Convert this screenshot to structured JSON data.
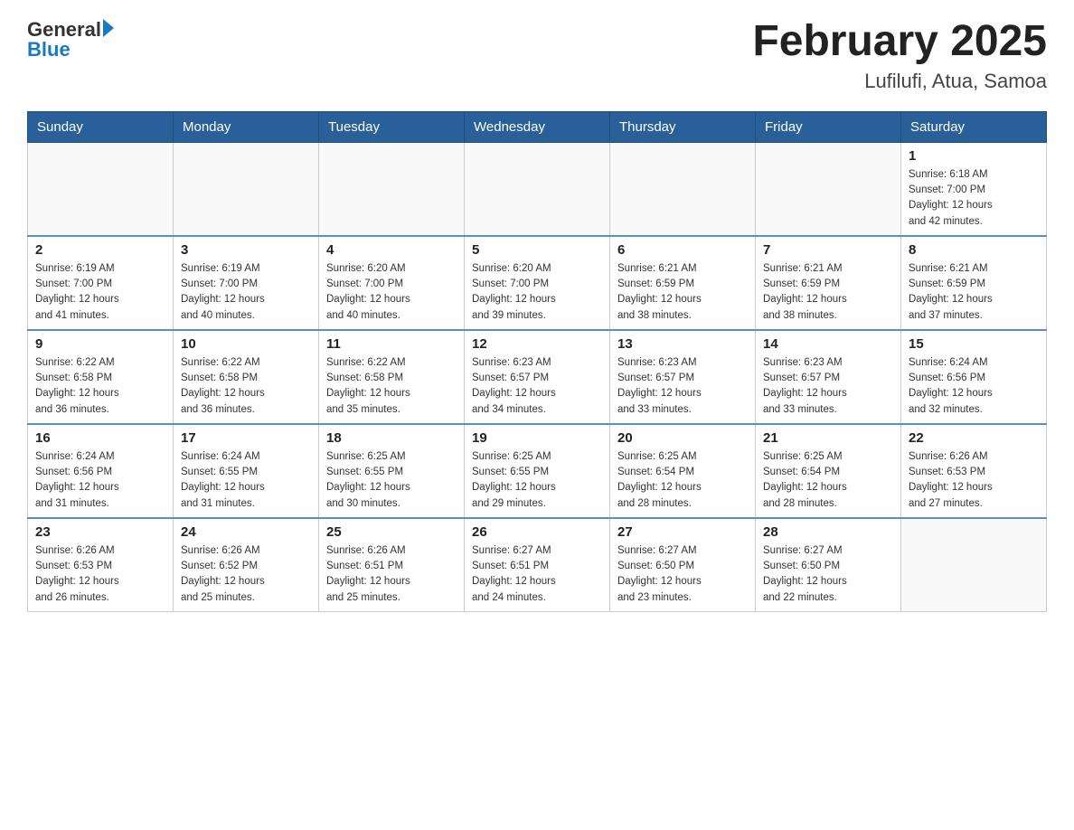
{
  "header": {
    "logo_general": "General",
    "logo_blue": "Blue",
    "month_title": "February 2025",
    "location": "Lufilufi, Atua, Samoa"
  },
  "weekdays": [
    "Sunday",
    "Monday",
    "Tuesday",
    "Wednesday",
    "Thursday",
    "Friday",
    "Saturday"
  ],
  "weeks": [
    [
      {
        "day": "",
        "info": ""
      },
      {
        "day": "",
        "info": ""
      },
      {
        "day": "",
        "info": ""
      },
      {
        "day": "",
        "info": ""
      },
      {
        "day": "",
        "info": ""
      },
      {
        "day": "",
        "info": ""
      },
      {
        "day": "1",
        "info": "Sunrise: 6:18 AM\nSunset: 7:00 PM\nDaylight: 12 hours\nand 42 minutes."
      }
    ],
    [
      {
        "day": "2",
        "info": "Sunrise: 6:19 AM\nSunset: 7:00 PM\nDaylight: 12 hours\nand 41 minutes."
      },
      {
        "day": "3",
        "info": "Sunrise: 6:19 AM\nSunset: 7:00 PM\nDaylight: 12 hours\nand 40 minutes."
      },
      {
        "day": "4",
        "info": "Sunrise: 6:20 AM\nSunset: 7:00 PM\nDaylight: 12 hours\nand 40 minutes."
      },
      {
        "day": "5",
        "info": "Sunrise: 6:20 AM\nSunset: 7:00 PM\nDaylight: 12 hours\nand 39 minutes."
      },
      {
        "day": "6",
        "info": "Sunrise: 6:21 AM\nSunset: 6:59 PM\nDaylight: 12 hours\nand 38 minutes."
      },
      {
        "day": "7",
        "info": "Sunrise: 6:21 AM\nSunset: 6:59 PM\nDaylight: 12 hours\nand 38 minutes."
      },
      {
        "day": "8",
        "info": "Sunrise: 6:21 AM\nSunset: 6:59 PM\nDaylight: 12 hours\nand 37 minutes."
      }
    ],
    [
      {
        "day": "9",
        "info": "Sunrise: 6:22 AM\nSunset: 6:58 PM\nDaylight: 12 hours\nand 36 minutes."
      },
      {
        "day": "10",
        "info": "Sunrise: 6:22 AM\nSunset: 6:58 PM\nDaylight: 12 hours\nand 36 minutes."
      },
      {
        "day": "11",
        "info": "Sunrise: 6:22 AM\nSunset: 6:58 PM\nDaylight: 12 hours\nand 35 minutes."
      },
      {
        "day": "12",
        "info": "Sunrise: 6:23 AM\nSunset: 6:57 PM\nDaylight: 12 hours\nand 34 minutes."
      },
      {
        "day": "13",
        "info": "Sunrise: 6:23 AM\nSunset: 6:57 PM\nDaylight: 12 hours\nand 33 minutes."
      },
      {
        "day": "14",
        "info": "Sunrise: 6:23 AM\nSunset: 6:57 PM\nDaylight: 12 hours\nand 33 minutes."
      },
      {
        "day": "15",
        "info": "Sunrise: 6:24 AM\nSunset: 6:56 PM\nDaylight: 12 hours\nand 32 minutes."
      }
    ],
    [
      {
        "day": "16",
        "info": "Sunrise: 6:24 AM\nSunset: 6:56 PM\nDaylight: 12 hours\nand 31 minutes."
      },
      {
        "day": "17",
        "info": "Sunrise: 6:24 AM\nSunset: 6:55 PM\nDaylight: 12 hours\nand 31 minutes."
      },
      {
        "day": "18",
        "info": "Sunrise: 6:25 AM\nSunset: 6:55 PM\nDaylight: 12 hours\nand 30 minutes."
      },
      {
        "day": "19",
        "info": "Sunrise: 6:25 AM\nSunset: 6:55 PM\nDaylight: 12 hours\nand 29 minutes."
      },
      {
        "day": "20",
        "info": "Sunrise: 6:25 AM\nSunset: 6:54 PM\nDaylight: 12 hours\nand 28 minutes."
      },
      {
        "day": "21",
        "info": "Sunrise: 6:25 AM\nSunset: 6:54 PM\nDaylight: 12 hours\nand 28 minutes."
      },
      {
        "day": "22",
        "info": "Sunrise: 6:26 AM\nSunset: 6:53 PM\nDaylight: 12 hours\nand 27 minutes."
      }
    ],
    [
      {
        "day": "23",
        "info": "Sunrise: 6:26 AM\nSunset: 6:53 PM\nDaylight: 12 hours\nand 26 minutes."
      },
      {
        "day": "24",
        "info": "Sunrise: 6:26 AM\nSunset: 6:52 PM\nDaylight: 12 hours\nand 25 minutes."
      },
      {
        "day": "25",
        "info": "Sunrise: 6:26 AM\nSunset: 6:51 PM\nDaylight: 12 hours\nand 25 minutes."
      },
      {
        "day": "26",
        "info": "Sunrise: 6:27 AM\nSunset: 6:51 PM\nDaylight: 12 hours\nand 24 minutes."
      },
      {
        "day": "27",
        "info": "Sunrise: 6:27 AM\nSunset: 6:50 PM\nDaylight: 12 hours\nand 23 minutes."
      },
      {
        "day": "28",
        "info": "Sunrise: 6:27 AM\nSunset: 6:50 PM\nDaylight: 12 hours\nand 22 minutes."
      },
      {
        "day": "",
        "info": ""
      }
    ]
  ]
}
